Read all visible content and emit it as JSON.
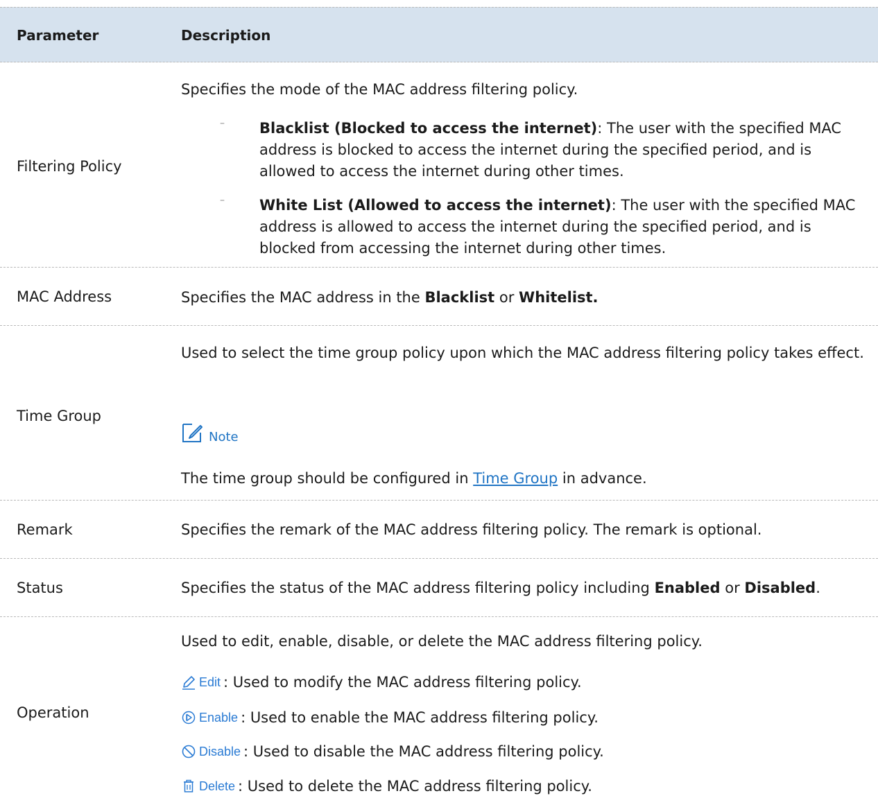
{
  "header": {
    "param": "Parameter",
    "desc": "Description"
  },
  "filtering_policy": {
    "param": "Filtering Policy",
    "intro": "Specifies the mode of the MAC address filtering policy.",
    "blacklist_title": "Blacklist (Blocked to access the internet)",
    "blacklist_text": ": The user with the specified MAC address is blocked to access the internet during the specified period, and is allowed to access the internet during other times.",
    "whitelist_title": "White List (Allowed to access the internet)",
    "whitelist_text": ": The user with the specified MAC address is allowed to access the internet during the specified period, and is blocked from accessing the internet during other times."
  },
  "mac_address": {
    "param": "MAC Address",
    "text_a": "Specifies the MAC address in the ",
    "bold_a": "Blacklist",
    "text_b": " or ",
    "bold_b": "Whitelist."
  },
  "time_group": {
    "param": "Time Group",
    "intro": "Used to select the time group policy upon which the MAC address filtering policy takes effect.",
    "note_label": "Note",
    "note_text_a": "The time group should be configured in ",
    "note_link": "Time Group",
    "note_text_b": " in advance."
  },
  "remark": {
    "param": "Remark",
    "text": "Specifies the remark of the MAC address filtering policy. The remark is optional."
  },
  "status": {
    "param": "Status",
    "text_a": "Specifies the status of the MAC address filtering policy including ",
    "bold_a": "Enabled",
    "text_b": " or ",
    "bold_b": "Disabled",
    "text_c": "."
  },
  "operation": {
    "param": "Operation",
    "intro": "Used to edit, enable, disable, or delete the MAC address filtering policy.",
    "items": [
      {
        "icon": "edit-pencil-icon",
        "label": "Edit",
        "text": ": Used to modify the MAC address filtering policy."
      },
      {
        "icon": "enable-play-icon",
        "label": "Enable",
        "text": ": Used to enable the MAC address filtering policy."
      },
      {
        "icon": "disable-ban-icon",
        "label": "Disable",
        "text": " : Used to disable the MAC address filtering policy."
      },
      {
        "icon": "delete-trash-icon",
        "label": "Delete",
        "text": " : Used to delete the MAC address filtering policy."
      }
    ]
  },
  "colors": {
    "header_bg": "#d6e2ee",
    "link": "#1f74c4",
    "icon": "#2a7bd4",
    "divider": "#b9b9b9"
  }
}
